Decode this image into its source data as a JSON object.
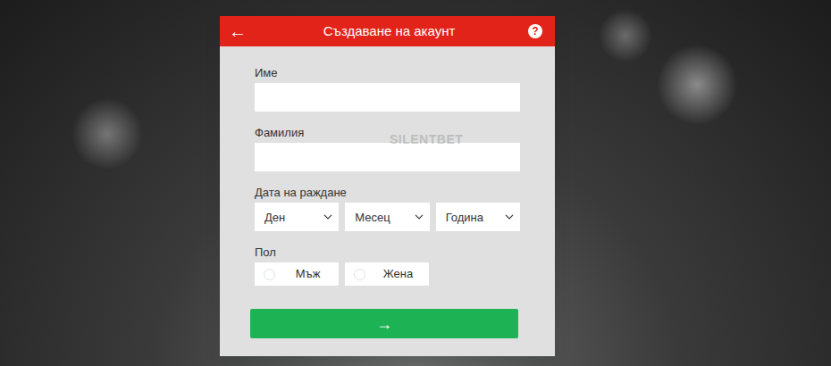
{
  "header": {
    "back_icon": "←",
    "title": "Създаване на акаунт",
    "help_icon": "?"
  },
  "watermark": "SILENTBET",
  "fields": [
    {
      "label": "Име"
    },
    {
      "label": "Фамилия"
    }
  ],
  "birthdate": {
    "label": "Дата на раждане",
    "selects": [
      "Ден",
      "Месец",
      "Година"
    ]
  },
  "gender": {
    "label": "Пол",
    "options": [
      {
        "label": "Мъж",
        "selected": false
      },
      {
        "label": "Жена",
        "selected": false
      }
    ]
  },
  "submit": {
    "icon": "→"
  }
}
